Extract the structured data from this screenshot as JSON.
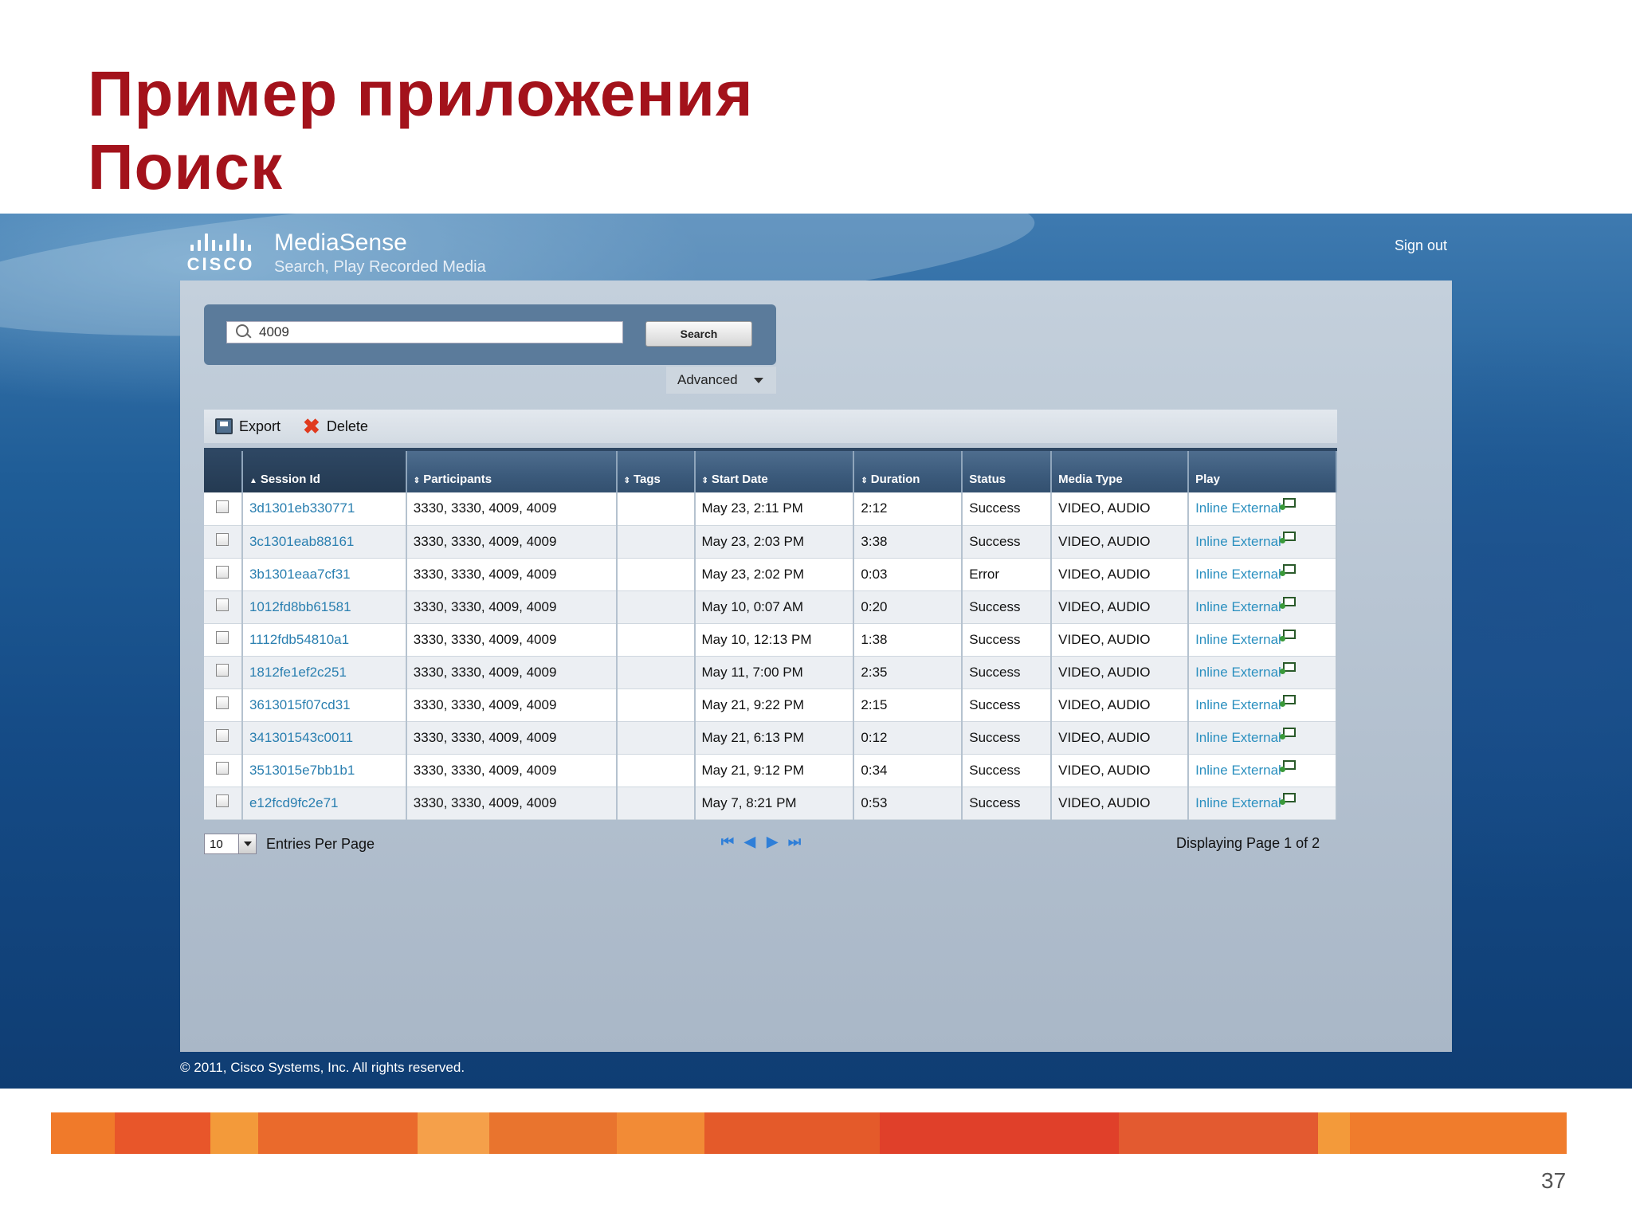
{
  "slide": {
    "title_line1": "Пример приложения",
    "title_line2": "Поиск",
    "page_number": "37"
  },
  "app": {
    "logo_word": "CISCO",
    "name": "MediaSense",
    "subtitle": "Search, Play Recorded Media",
    "signout_label": "Sign out",
    "copyright": "© 2011, Cisco Systems, Inc. All rights reserved."
  },
  "search": {
    "value": "4009",
    "button_label": "Search",
    "advanced_label": "Advanced"
  },
  "toolbar": {
    "export_label": "Export",
    "delete_label": "Delete"
  },
  "table": {
    "headers": {
      "session_id": "Session Id",
      "participants": "Participants",
      "tags": "Tags",
      "start_date": "Start Date",
      "duration": "Duration",
      "status": "Status",
      "media_type": "Media Type",
      "play": "Play"
    },
    "rows": [
      {
        "session_id": "3d1301eb330771",
        "participants": "3330, 3330, 4009, 4009",
        "tags": "",
        "start_date": "May 23, 2:11 PM",
        "duration": "2:12",
        "status": "Success",
        "media_type": "VIDEO, AUDIO",
        "play_inline": "Inline",
        "play_external": "External"
      },
      {
        "session_id": "3c1301eab88161",
        "participants": "3330, 3330, 4009, 4009",
        "tags": "",
        "start_date": "May 23, 2:03 PM",
        "duration": "3:38",
        "status": "Success",
        "media_type": "VIDEO, AUDIO",
        "play_inline": "Inline",
        "play_external": "External"
      },
      {
        "session_id": "3b1301eaa7cf31",
        "participants": "3330, 3330, 4009, 4009",
        "tags": "",
        "start_date": "May 23, 2:02 PM",
        "duration": "0:03",
        "status": "Error",
        "media_type": "VIDEO, AUDIO",
        "play_inline": "Inline",
        "play_external": "External"
      },
      {
        "session_id": "1012fd8bb61581",
        "participants": "3330, 3330, 4009, 4009",
        "tags": "",
        "start_date": "May 10, 0:07 AM",
        "duration": "0:20",
        "status": "Success",
        "media_type": "VIDEO, AUDIO",
        "play_inline": "Inline",
        "play_external": "External"
      },
      {
        "session_id": "1112fdb54810a1",
        "participants": "3330, 3330, 4009, 4009",
        "tags": "",
        "start_date": "May 10, 12:13 PM",
        "duration": "1:38",
        "status": "Success",
        "media_type": "VIDEO, AUDIO",
        "play_inline": "Inline",
        "play_external": "External"
      },
      {
        "session_id": "1812fe1ef2c251",
        "participants": "3330, 3330, 4009, 4009",
        "tags": "",
        "start_date": "May 11, 7:00 PM",
        "duration": "2:35",
        "status": "Success",
        "media_type": "VIDEO, AUDIO",
        "play_inline": "Inline",
        "play_external": "External"
      },
      {
        "session_id": "3613015f07cd31",
        "participants": "3330, 3330, 4009, 4009",
        "tags": "",
        "start_date": "May 21, 9:22 PM",
        "duration": "2:15",
        "status": "Success",
        "media_type": "VIDEO, AUDIO",
        "play_inline": "Inline",
        "play_external": "External"
      },
      {
        "session_id": "341301543c0011",
        "participants": "3330, 3330, 4009, 4009",
        "tags": "",
        "start_date": "May 21, 6:13 PM",
        "duration": "0:12",
        "status": "Success",
        "media_type": "VIDEO, AUDIO",
        "play_inline": "Inline",
        "play_external": "External"
      },
      {
        "session_id": "3513015e7bb1b1",
        "participants": "3330, 3330, 4009, 4009",
        "tags": "",
        "start_date": "May 21, 9:12 PM",
        "duration": "0:34",
        "status": "Success",
        "media_type": "VIDEO, AUDIO",
        "play_inline": "Inline",
        "play_external": "External"
      },
      {
        "session_id": "e12fcd9fc2e71",
        "participants": "3330, 3330, 4009, 4009",
        "tags": "",
        "start_date": "May 7, 8:21 PM",
        "duration": "0:53",
        "status": "Success",
        "media_type": "VIDEO, AUDIO",
        "play_inline": "Inline",
        "play_external": "External"
      }
    ]
  },
  "pager": {
    "entries_value": "10",
    "entries_label": "Entries Per Page",
    "display_text": "Displaying Page 1 of 2",
    "first_icon": "first-page-icon",
    "prev_icon": "prev-page-icon",
    "next_icon": "next-page-icon",
    "last_icon": "last-page-icon"
  },
  "colors": {
    "title_red": "#a3121b",
    "link_blue": "#2a7fb0",
    "header_blue": "#3b5a7b"
  }
}
